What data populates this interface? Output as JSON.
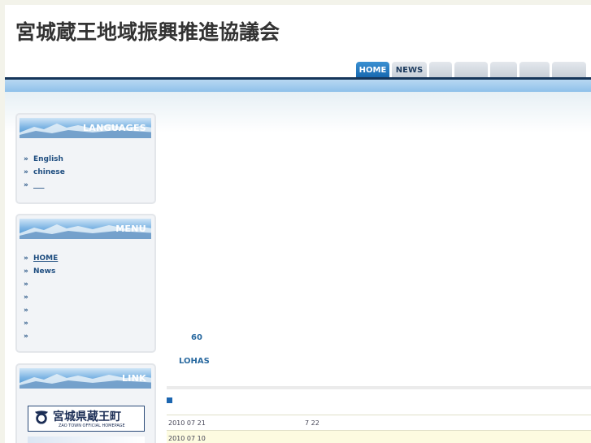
{
  "site": {
    "title": "宮城蔵王地域振興推進協議会"
  },
  "nav": {
    "tabs": [
      {
        "label": "HOME",
        "active": true
      },
      {
        "label": "NEWS",
        "active": false
      },
      {
        "label": "",
        "active": false
      },
      {
        "label": "",
        "active": false
      },
      {
        "label": "",
        "active": false
      },
      {
        "label": "",
        "active": false
      },
      {
        "label": "",
        "active": false
      }
    ]
  },
  "sidebar": {
    "languages": {
      "title": "LANGUAGES",
      "items": [
        "English",
        "chinese",
        "___"
      ]
    },
    "menu": {
      "title": "MENU",
      "items": [
        "HOME",
        "News",
        "",
        "",
        "",
        "",
        ""
      ]
    },
    "link": {
      "title": "LINK",
      "banner_name": "宮城県蔵王町",
      "banner_sub": "ZAO TOWN OFFICIAL HOMEPAGE"
    },
    "bullet": "»"
  },
  "main": {
    "text_60": "60",
    "text_lohas": "LOHAS"
  },
  "news": {
    "rows": [
      {
        "date": "2010 07 21",
        "title": "7 22"
      },
      {
        "date": "2010 07 10",
        "title": ""
      }
    ]
  },
  "colors": {
    "accent": "#1566ae",
    "nav_line": "#16365a",
    "link_text": "#1f4e80",
    "row_highlight": "#fdfbe0"
  }
}
